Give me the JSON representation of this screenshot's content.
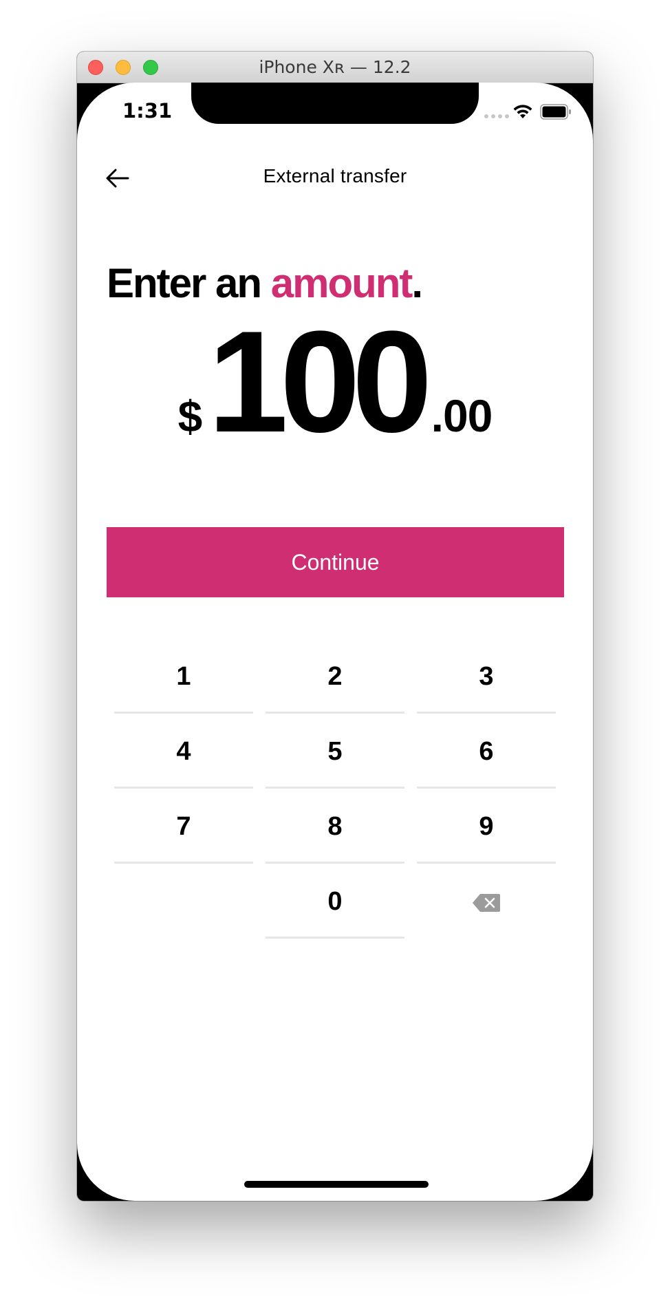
{
  "window": {
    "title": "iPhone Xʀ — 12.2"
  },
  "status_bar": {
    "time": "1:31"
  },
  "nav": {
    "title": "External transfer"
  },
  "heading": {
    "prefix": "Enter an ",
    "accent": "amount",
    "suffix": "."
  },
  "amount": {
    "currency": "$",
    "dollars": "100",
    "cents": ".00"
  },
  "continue_label": "Continue",
  "keypad": {
    "keys": [
      "1",
      "2",
      "3",
      "4",
      "5",
      "6",
      "7",
      "8",
      "9",
      "0"
    ]
  },
  "colors": {
    "accent": "#cf2e72"
  }
}
